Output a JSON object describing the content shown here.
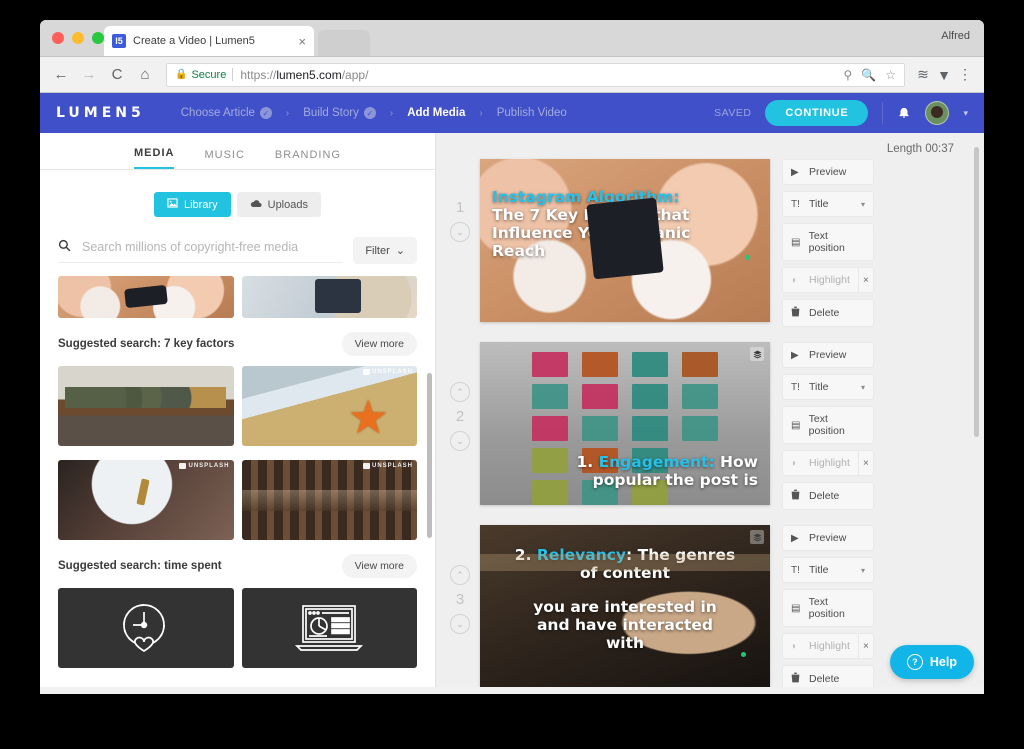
{
  "browser": {
    "profile_name": "Alfred",
    "tab_title": "Create a Video | Lumen5",
    "favicon_text": "l5",
    "tab_close": "×",
    "back": "←",
    "forward": "→",
    "reload": "C",
    "home": "⌂",
    "lock": "🔒",
    "secure_label": "Secure",
    "url_scheme": "https://",
    "url_host": "lumen5.com",
    "url_path": "/app/",
    "omni_icons": [
      "⚲",
      "⚲",
      "☆"
    ],
    "ext_icons": [
      "≋",
      "▼",
      "⋮"
    ]
  },
  "appbar": {
    "logo": "LUMEN5",
    "steps": [
      {
        "label": "Choose Article",
        "done": true,
        "active": false
      },
      {
        "label": "Build Story",
        "done": true,
        "active": false
      },
      {
        "label": "Add Media",
        "done": false,
        "active": true
      },
      {
        "label": "Publish Video",
        "done": false,
        "active": false
      }
    ],
    "chevron": "›",
    "check_glyph": "✓",
    "saved_label": "SAVED",
    "continue_label": "CONTINUE",
    "bell_glyph": "🔔",
    "caret_glyph": "▾",
    "accent_color": "#21c3e0",
    "bar_color": "#4050c8"
  },
  "media_panel": {
    "tabs": [
      {
        "label": "MEDIA",
        "active": true
      },
      {
        "label": "MUSIC",
        "active": false
      },
      {
        "label": "BRANDING",
        "active": false
      }
    ],
    "segments": [
      {
        "label": "Library",
        "icon": "🖼",
        "active": true
      },
      {
        "label": "Uploads",
        "icon": "☁",
        "active": false
      }
    ],
    "search": {
      "placeholder": "Search millions of copyright-free media",
      "value": "",
      "icon": "search-icon"
    },
    "filter_label": "Filter",
    "filter_caret": "⌄",
    "unsplash_badge": "UNSPLASH",
    "sections": [
      {
        "title": "Suggested search: 7 key factors",
        "view_more": "View more",
        "rows": [
          [
            {
              "alt": "military meeting around table",
              "style": "ph-meeting",
              "badge": false
            },
            {
              "alt": "orange starfish on sand",
              "style": "ph-star",
              "badge": true
            }
          ],
          [
            {
              "alt": "woman holding key necklace",
              "style": "ph-key",
              "badge": true
            },
            {
              "alt": "antique piano keys",
              "style": "ph-piano",
              "badge": true
            }
          ]
        ]
      },
      {
        "title": "Suggested search: time spent",
        "view_more": "View more",
        "rows": [
          [
            {
              "alt": "clock and heart line icon",
              "style": "ph-dark",
              "badge": false,
              "icon": "clock-heart"
            },
            {
              "alt": "laptop with pie chart line icon",
              "style": "ph-dark",
              "badge": false,
              "icon": "laptop-chart"
            }
          ]
        ]
      }
    ],
    "top_clipped_row": [
      {
        "alt": "hands with plates of food",
        "style": "ph-food",
        "badge": false
      },
      {
        "alt": "hand holding smartphone",
        "style": "ph-phone",
        "badge": false
      }
    ]
  },
  "storyboard": {
    "length_label": "Length 00:37",
    "actions": {
      "preview": "Preview",
      "preview_icon": "▶",
      "title": "Title",
      "title_icon": "T!",
      "title_caret": "▾",
      "text_position": "Text position",
      "text_position_icon": "▤",
      "highlight": "Highlight",
      "highlight_icon": "◗",
      "highlight_remove": "×",
      "delete": "Delete",
      "delete_icon": "🗑"
    },
    "up_arrow": "⌃",
    "down_arrow": "⌄",
    "layers_icon": "▤",
    "scenes": [
      {
        "number": "1",
        "bg": "ph-food",
        "has_up": false,
        "has_down": true,
        "has_layers_icon": false,
        "green_dot": true,
        "text_align": "left",
        "text_top": "30px",
        "lines": [
          {
            "text": "Instagram Algorithm:",
            "accent": true
          },
          {
            "text": "The 7 Key Factors that",
            "accent": false
          },
          {
            "text": "Influence Your Organic",
            "accent": false
          },
          {
            "text": "Reach",
            "accent": false
          }
        ]
      },
      {
        "number": "2",
        "bg": "ph-notes",
        "has_up": true,
        "has_down": true,
        "has_layers_icon": true,
        "green_dot": false,
        "text_align": "right",
        "text_top": "112px",
        "lines": [
          {
            "text": "1. ",
            "accent": false,
            "inline": true
          },
          {
            "text": "Engagement:",
            "accent": true,
            "inline": true
          },
          {
            "text": " How",
            "accent": false,
            "inline": true
          },
          {
            "text": "popular the post is",
            "accent": false
          }
        ]
      },
      {
        "number": "3",
        "bg": "ph-hands",
        "has_up": true,
        "has_down": true,
        "has_layers_icon": true,
        "green_dot": true,
        "text_align": "center",
        "text_top": "22px",
        "lines": [
          {
            "text": "2. ",
            "accent": false,
            "inline": true
          },
          {
            "text": "Relevancy",
            "accent": true,
            "inline": true
          },
          {
            "text": ": The genres",
            "accent": false,
            "inline": true
          },
          {
            "text": "of content",
            "accent": false
          },
          {
            "text": "",
            "accent": false
          },
          {
            "text": "you are interested in",
            "accent": false
          },
          {
            "text": "and have interacted",
            "accent": false
          },
          {
            "text": "with",
            "accent": false
          }
        ]
      }
    ],
    "help_label": "Help",
    "help_icon": "?"
  }
}
